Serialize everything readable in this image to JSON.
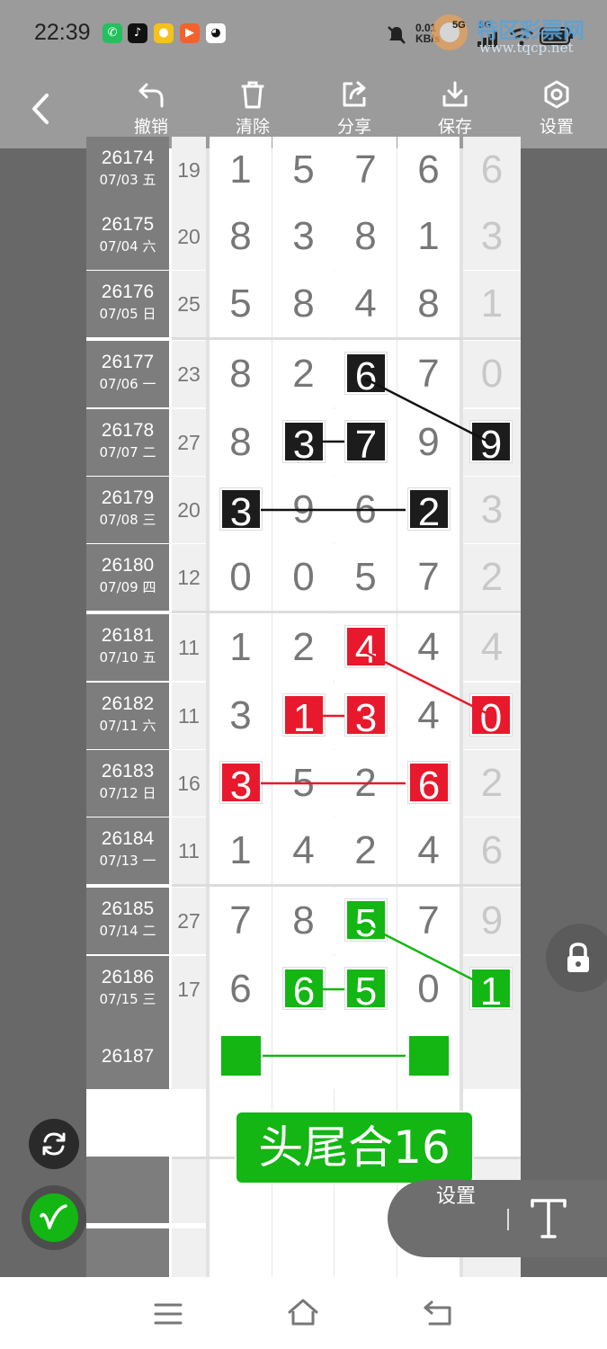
{
  "status_bar": {
    "time": "22:39",
    "network_speed_top": "0.01",
    "network_speed_unit": "KB/s",
    "signal_label": "5G",
    "watermark_title": "特区彩票网",
    "watermark_url": "www.tqcp.net"
  },
  "toolbar": {
    "undo_label": "撤销",
    "clear_label": "清除",
    "share_label": "分享",
    "save_label": "保存",
    "settings_label": "设置"
  },
  "rows": [
    {
      "period": "26174",
      "date": "07/03 五",
      "sum": "19",
      "digits": [
        "1",
        "5",
        "7",
        "6"
      ],
      "extra": "6"
    },
    {
      "period": "26175",
      "date": "07/04 六",
      "sum": "20",
      "digits": [
        "8",
        "3",
        "8",
        "1"
      ],
      "extra": "3"
    },
    {
      "period": "26176",
      "date": "07/05 日",
      "sum": "25",
      "digits": [
        "5",
        "8",
        "4",
        "8"
      ],
      "extra": "1"
    },
    {
      "period": "26177",
      "date": "07/06 一",
      "sum": "23",
      "digits": [
        "8",
        "2",
        "6",
        "7"
      ],
      "extra": "0"
    },
    {
      "period": "26178",
      "date": "07/07 二",
      "sum": "27",
      "digits": [
        "8",
        "3",
        "7",
        "9"
      ],
      "extra": "9"
    },
    {
      "period": "26179",
      "date": "07/08 三",
      "sum": "20",
      "digits": [
        "3",
        "9",
        "6",
        "2"
      ],
      "extra": "3"
    },
    {
      "period": "26180",
      "date": "07/09 四",
      "sum": "12",
      "digits": [
        "0",
        "0",
        "5",
        "7"
      ],
      "extra": "2"
    },
    {
      "period": "26181",
      "date": "07/10 五",
      "sum": "11",
      "digits": [
        "1",
        "2",
        "4",
        "4"
      ],
      "extra": "4"
    },
    {
      "period": "26182",
      "date": "07/11 六",
      "sum": "11",
      "digits": [
        "3",
        "1",
        "3",
        "4"
      ],
      "extra": "0"
    },
    {
      "period": "26183",
      "date": "07/12 日",
      "sum": "16",
      "digits": [
        "3",
        "5",
        "2",
        "6"
      ],
      "extra": "2"
    },
    {
      "period": "26184",
      "date": "07/13 一",
      "sum": "11",
      "digits": [
        "1",
        "4",
        "2",
        "4"
      ],
      "extra": "6"
    },
    {
      "period": "26185",
      "date": "07/14 二",
      "sum": "27",
      "digits": [
        "7",
        "8",
        "5",
        "7"
      ],
      "extra": "9"
    },
    {
      "period": "26186",
      "date": "07/15 三",
      "sum": "17",
      "digits": [
        "6",
        "6",
        "5",
        "0"
      ],
      "extra": "1"
    },
    {
      "period": "26187"
    }
  ],
  "banner_text": "头尾合16",
  "floating": {
    "settings_label": "设置",
    "colors": {
      "accent_green": "#13b613",
      "accent_red": "#e8192c",
      "mark_black": "#1c1c1c"
    }
  }
}
